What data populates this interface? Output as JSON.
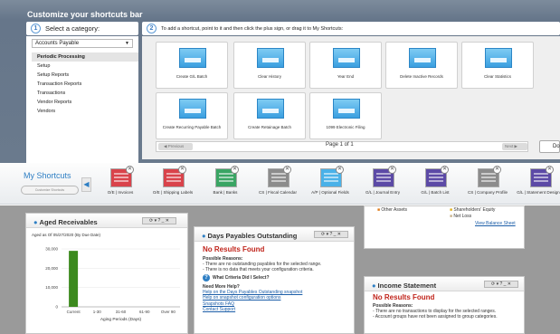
{
  "customize": {
    "title": "Customize your shortcuts bar",
    "step1": {
      "num": "1",
      "label": "Select a category:"
    },
    "step2": {
      "num": "2",
      "label": "To add a shortcut, point to it and then click the plus sign, or drag it to My Shortcuts:"
    },
    "category_selected": "Accounts Payable",
    "categories": [
      "Periodic Processing",
      "Setup",
      "Setup Reports",
      "Transaction Reports",
      "Transactions",
      "Vendor Reports",
      "Vendors"
    ],
    "tiles": [
      "Create G/L Batch",
      "Clear History",
      "Year End",
      "Delete Inactive Records",
      "Clear Statistics",
      "Create Recurring Payable Batch",
      "Create Retainage Batch",
      "1099 Electronic Filing"
    ],
    "pager": {
      "prev": "Previous",
      "text": "Page 1 of 1",
      "next": "Next"
    },
    "done": "Done"
  },
  "shortcuts": {
    "title": "My Shortcuts",
    "customize_button": "Customize Shortcuts",
    "items": [
      {
        "label": "O/E | Invoices",
        "color": "#d9434b"
      },
      {
        "label": "O/E | Shipping Labels",
        "color": "#d9434b"
      },
      {
        "label": "Bank | Banks",
        "color": "#3aa564"
      },
      {
        "label": "CS | Fiscal Calendar",
        "color": "#8c8c8c"
      },
      {
        "label": "A/P | Optional Fields",
        "color": "#4ab1e8"
      },
      {
        "label": "G/L | Journal Entry",
        "color": "#5c4aa6"
      },
      {
        "label": "G/L | Batch List",
        "color": "#5c4aa6"
      },
      {
        "label": "CS | Company Profile",
        "color": "#8c8c8c"
      },
      {
        "label": "G/L | Statement Designer",
        "color": "#5c4aa6"
      }
    ]
  },
  "aged_receivables": {
    "title": "Aged Receivables",
    "controls": "⟳ ▾ ? _ ✕",
    "subtitle": "Aged as Of 05/27/2020 (By Due Date)",
    "chart_data": {
      "type": "bar",
      "categories": [
        "Current",
        "1-30",
        "31-60",
        "61-90",
        "Over 90"
      ],
      "values": [
        29000,
        0,
        0,
        0,
        0
      ],
      "ylabel": "",
      "xlabel": "Aging Periods (Days)",
      "yticks": [
        "30,000",
        "20,000",
        "10,000",
        "0"
      ],
      "ylim": [
        0,
        30000
      ],
      "color": "#3c8a1e"
    }
  },
  "days_payables": {
    "title": "Days Payables Outstanding",
    "controls": "⟳ ▾ ? _ ✕",
    "no_results": "No Results Found",
    "possible_reasons": "Possible Reasons:",
    "reason1": "- There are no outstanding payables for the selected range.",
    "reason2": "- There is no data that meets your configuration criteria.",
    "criteria": "What Criteria Did I Select?",
    "need_help": "Need More Help?",
    "links": [
      "Help on the Days Payables Outstanding snapshot",
      "Help on snapshot configuration options",
      "Snapshots FAQ",
      "Contact Support"
    ]
  },
  "top_right": {
    "legend1": "Other Assets",
    "legend2": "Shareholders' Equity",
    "legend3": "Net Loss",
    "link": "View Balance Sheet"
  },
  "income_statement": {
    "title": "Income Statement",
    "controls": "⟳ ▾ ? _ ✕",
    "no_results": "No Results Found",
    "possible_reasons": "Possible Reasons:",
    "reason1": "- There are no transactions to display for the selected ranges.",
    "reason2": "- Account groups have not been assigned to group categories."
  }
}
